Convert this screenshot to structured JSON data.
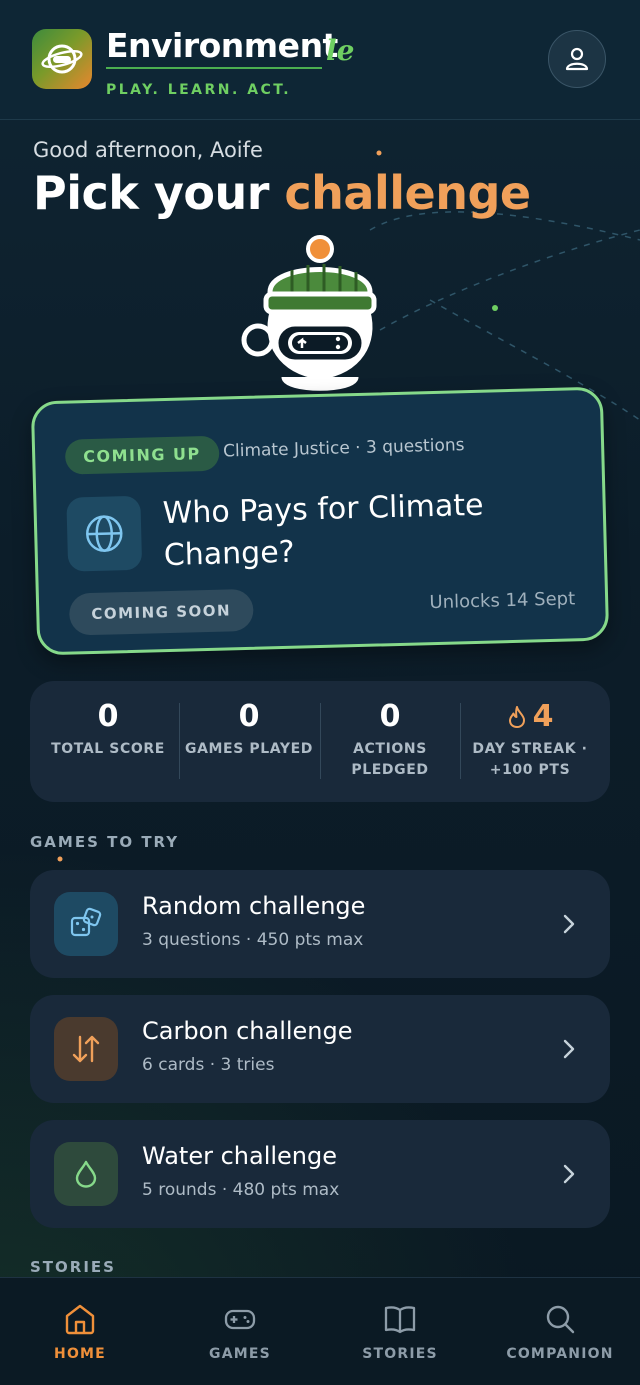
{
  "app": {
    "brand": "Environment",
    "brand_suffix": "le",
    "tagline": "PLAY. LEARN. ACT."
  },
  "colors": {
    "accent_orange": "#f0a05a",
    "accent_green": "#86d98a",
    "background": "#0c1b26",
    "card": "#19293a"
  },
  "greeting": "Good afternoon, Aoife",
  "title": {
    "prefix": "Pick your",
    "accent": "challenge"
  },
  "featured": {
    "badge": "COMING UP",
    "meta": "Climate Justice · 3 questions",
    "icon": "globe-icon",
    "title": "Who Pays for Climate Change?",
    "status": "COMING SOON",
    "unlocks": "Unlocks 14 Sept"
  },
  "stats": [
    {
      "value": "0",
      "label": "TOTAL SCORE"
    },
    {
      "value": "0",
      "label": "GAMES PLAYED"
    },
    {
      "value": "0",
      "label_line1": "ACTIONS",
      "label_line2": "PLEDGED"
    },
    {
      "value": "4",
      "label_line1": "DAY STREAK ·",
      "label_line2": "+100 PTS",
      "icon": "flame-icon"
    }
  ],
  "sections": {
    "games": "GAMES TO TRY",
    "stories": "STORIES"
  },
  "games": [
    {
      "title": "Random challenge",
      "subtitle": "3 questions · 450 pts max",
      "icon": "dice-icon",
      "icon_bg": "#1e4a63"
    },
    {
      "title": "Carbon challenge",
      "subtitle": "6 cards · 3 tries",
      "icon": "swap-arrows-icon",
      "icon_bg": "#4a3a2e"
    },
    {
      "title": "Water challenge",
      "subtitle": "5 rounds · 480 pts max",
      "icon": "water-drop-icon",
      "icon_bg": "#2e4a3c"
    }
  ],
  "nav": [
    {
      "label": "HOME",
      "icon": "home-icon",
      "active": true
    },
    {
      "label": "GAMES",
      "icon": "gamepad-icon",
      "active": false
    },
    {
      "label": "STORIES",
      "icon": "book-icon",
      "active": false
    },
    {
      "label": "COMPANION",
      "icon": "search-icon",
      "active": false
    }
  ]
}
